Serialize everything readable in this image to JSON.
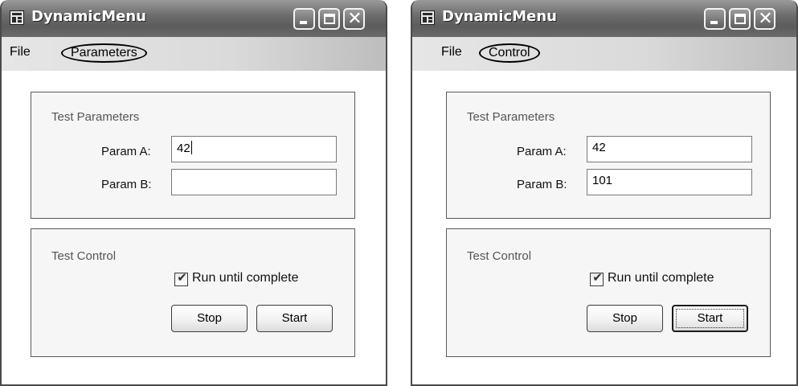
{
  "windows": [
    {
      "title": "DynamicMenu",
      "menu": [
        {
          "label": "File",
          "circled": false
        },
        {
          "label": "Parameters",
          "circled": true
        }
      ],
      "params_group": {
        "title": "Test Parameters",
        "param_a": {
          "label": "Param A:",
          "value": "42",
          "focused": true
        },
        "param_b": {
          "label": "Param B:",
          "value": ""
        }
      },
      "control_group": {
        "title": "Test Control",
        "checkbox": {
          "label": "Run until complete",
          "checked": true
        },
        "stop_label": "Stop",
        "start_label": "Start",
        "start_focused": false
      }
    },
    {
      "title": "DynamicMenu",
      "menu": [
        {
          "label": "File",
          "circled": false
        },
        {
          "label": "Control",
          "circled": true
        }
      ],
      "params_group": {
        "title": "Test Parameters",
        "param_a": {
          "label": "Param A:",
          "value": "42",
          "focused": false
        },
        "param_b": {
          "label": "Param B:",
          "value": "101"
        }
      },
      "control_group": {
        "title": "Test Control",
        "checkbox": {
          "label": "Run until complete",
          "checked": true
        },
        "stop_label": "Stop",
        "start_label": "Start",
        "start_focused": true
      }
    }
  ],
  "icons": {
    "app": "app-window-icon",
    "minimize": "minimize-icon",
    "maximize": "maximize-icon",
    "close": "close-icon",
    "check": "checkmark-icon"
  }
}
